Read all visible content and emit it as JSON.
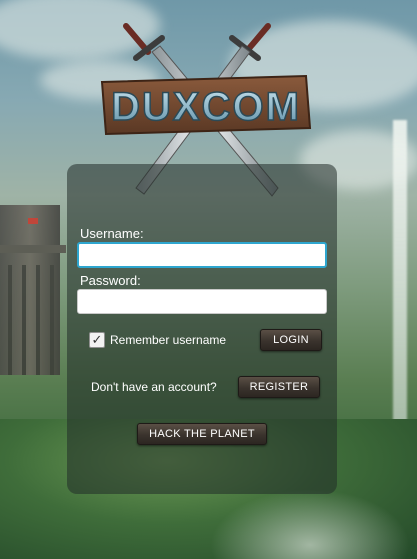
{
  "logo": {
    "text": "DUXCOM"
  },
  "login_form": {
    "username_label": "Username:",
    "username_value": "",
    "password_label": "Password:",
    "password_value": "",
    "remember_checked": true,
    "remember_label": "Remember username",
    "login_button": "LOGIN",
    "no_account_text": "Don't have an account?",
    "register_button": "REGISTER",
    "hack_button": "HACK THE PLANET"
  },
  "colors": {
    "focus_border": "#2ea6cf",
    "button_bg": "#3a332d"
  }
}
